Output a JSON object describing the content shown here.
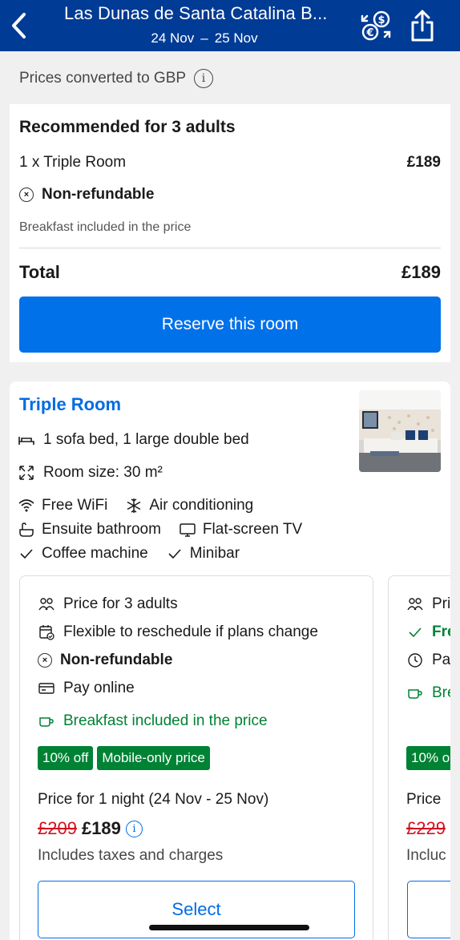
{
  "header": {
    "title": "Las Dunas de Santa Catalina B...",
    "date_from": "24 Nov",
    "date_sep": "–",
    "date_to": "25 Nov",
    "icons": [
      "back-arrow-icon",
      "currency-exchange-icon",
      "share-icon"
    ],
    "bg_color": "#003b95"
  },
  "price_note": {
    "text": "Prices converted to GBP",
    "icon": "info-icon"
  },
  "recommendation": {
    "title": "Recommended for 3 adults",
    "room_line": "1 x Triple Room",
    "room_price": "£189",
    "policy": "Non-refundable",
    "breakfast": "Breakfast included in the price",
    "total_label": "Total",
    "total_price": "£189",
    "reserve_label": "Reserve this room",
    "button_color": "#0071e9"
  },
  "room": {
    "name": "Triple Room",
    "beds": "1 sofa bed, 1 large double bed",
    "size": "Room size: 30 m²",
    "facilities": {
      "wifi": "Free WiFi",
      "ac": "Air conditioning",
      "bathroom": "Ensuite bathroom",
      "tv": "Flat-screen TV",
      "coffee": "Coffee machine",
      "minibar": "Minibar"
    }
  },
  "offer": {
    "guests": "Price for 3 adults",
    "flexible": "Flexible to reschedule if plans change",
    "policy": "Non-refundable",
    "payment": "Pay online",
    "breakfast": "Breakfast included in the price",
    "badge_discount": "10% off",
    "badge_mobile": "Mobile-only price",
    "nights": "Price for 1 night (24 Nov - 25 Nov)",
    "old_price": "£209",
    "new_price": "£189",
    "taxes": "Includes taxes and charges",
    "select_label": "Select",
    "green_color": "#008234"
  },
  "offer2": {
    "guests": "Pri",
    "flexible": "Fre",
    "payment": "Pa",
    "breakfast": "Bre",
    "badge_discount": "10% o",
    "nights": "Price",
    "old_price": "£229",
    "taxes": "Incluc"
  }
}
